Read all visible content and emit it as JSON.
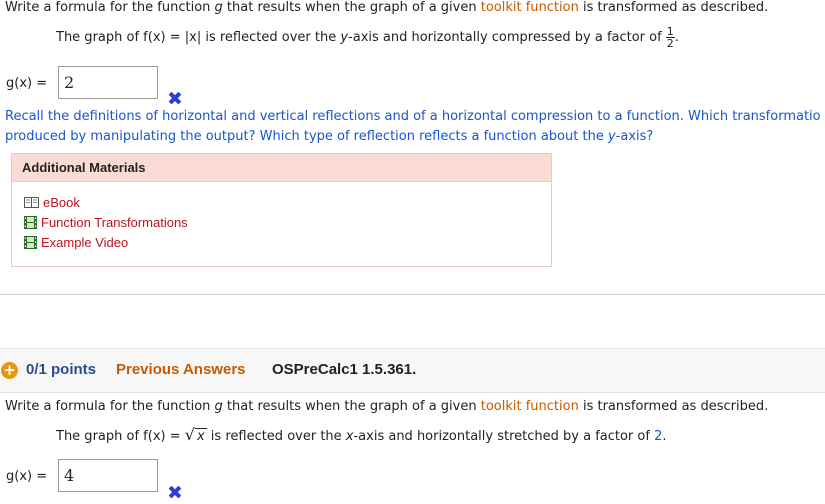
{
  "q1": {
    "prompt_a": "Write a formula for the function ",
    "prompt_g": "g",
    "prompt_b": " that results when the graph of a given ",
    "toolkit_link": "toolkit function",
    "prompt_c": " is transformed as described.",
    "desc_a": "The graph of ",
    "desc_f": "f(x)",
    "desc_eq": " = ",
    "desc_abs": "|x|",
    "desc_b": " is reflected over the ",
    "desc_axis": "y",
    "desc_c": "-axis and horizontally compressed by a factor of",
    "frac_num": "1",
    "frac_den": "2",
    "desc_end": ".",
    "gx_label": "g(x)",
    "gx_eq": " = ",
    "answer": "2",
    "hint_line1": "Recall the definitions of horizontal and vertical reflections and of a horizontal compression to a function. Which transformatio",
    "hint_line2_a": "produced by manipulating the output? Which type of reflection reflects a function about the ",
    "hint_axis": "y",
    "hint_line2_b": "-axis?"
  },
  "materials": {
    "title": "Additional Materials",
    "items": [
      {
        "label": "eBook",
        "icon": "book-icon"
      },
      {
        "label": "Function Transformations",
        "icon": "film-icon"
      },
      {
        "label": "Example Video",
        "icon": "film-icon"
      }
    ]
  },
  "q2_header": {
    "plus": "+",
    "points": "0/1 points",
    "previous": "Previous Answers",
    "code": "OSPreCalc1 1.5.361."
  },
  "q2": {
    "prompt_a": "Write a formula for the function ",
    "prompt_g": "g",
    "prompt_b": " that results when the graph of a given ",
    "toolkit_link": "toolkit function",
    "prompt_c": " is transformed as described.",
    "desc_a": "The graph of ",
    "desc_f": "f(x)",
    "desc_eq": " = ",
    "sqrt_sign": "√",
    "sqrt_x": "x",
    "desc_b": " is reflected over the ",
    "desc_axis": "x",
    "desc_c": "-axis and horizontally stretched by a factor of ",
    "factor": "2",
    "desc_end": ".",
    "gx_label": "g(x)",
    "gx_eq": " = ",
    "answer": "4"
  },
  "colors": {
    "link": "#1a55c9",
    "toolkit": "#c65a00",
    "wrong_mark": "#2b3fd6",
    "materials_header": "#fbdcd4",
    "points_badge": "#e8960c"
  }
}
